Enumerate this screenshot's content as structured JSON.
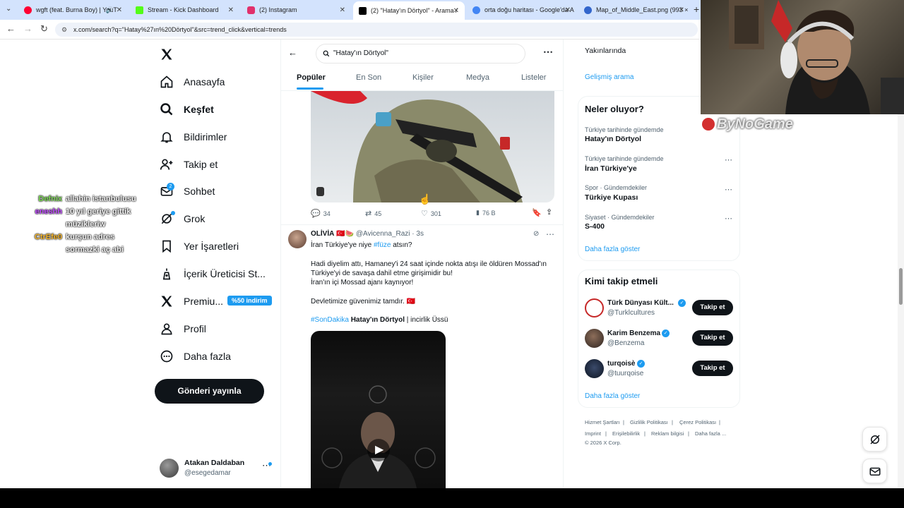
{
  "browser": {
    "tabs": [
      {
        "title": "wgft (feat. Burna Boy) | YouT",
        "color": "#ff0033"
      },
      {
        "title": "Stream - Kick Dashboard",
        "color": "#53fc18"
      },
      {
        "title": "(2) Instagram",
        "color": "#e1306c"
      },
      {
        "title": "(2) \"Hatay'ın Dörtyol\" - Arama /",
        "color": "#000000"
      },
      {
        "title": "orta doğu haritası - Google'da A",
        "color": "#4285f4"
      },
      {
        "title": "Map_of_Middle_East.png (993 ×",
        "color": "#3366cc"
      }
    ],
    "url": "x.com/search?q=\"Hatay%27ın%20Dörtyol\"&src=trend_click&vertical=trends"
  },
  "nav": {
    "items": [
      {
        "label": "Anasayfa",
        "icon": "home-icon"
      },
      {
        "label": "Keşfet",
        "icon": "search-icon"
      },
      {
        "label": "Bildirimler",
        "icon": "bell-icon"
      },
      {
        "label": "Takip et",
        "icon": "person-plus-icon"
      },
      {
        "label": "Sohbet",
        "icon": "mail-icon",
        "badge": "2"
      },
      {
        "label": "Grok",
        "icon": "grok-icon"
      },
      {
        "label": "Yer İşaretleri",
        "icon": "bookmark-icon"
      },
      {
        "label": "İçerik Üreticisi St...",
        "icon": "creator-icon"
      },
      {
        "label": "Premiu...",
        "icon": "x-logo-icon",
        "badge": "%50 indirim"
      },
      {
        "label": "Profil",
        "icon": "profile-icon"
      },
      {
        "label": "Daha fazla",
        "icon": "more-circle-icon"
      }
    ],
    "post_button": "Gönderi yayınla",
    "account": {
      "name": "Atakan Daldaban",
      "handle": "@esegedamar"
    }
  },
  "search": {
    "query": "\"Hatay'ın Dörtyol\"",
    "tabs": [
      "Popüler",
      "En Son",
      "Kişiler",
      "Medya",
      "Listeler"
    ]
  },
  "tweet1": {
    "replies": "34",
    "retweets": "45",
    "likes": "301",
    "views": "76 B"
  },
  "tweet2": {
    "name": "ΟLİVİA",
    "name_emoji": "🇹🇷🍉",
    "handle": "@Avicenna_Razi",
    "time": "· 3s",
    "line1_pre": "İran Türkiye'ye niye",
    "line1_tag": "#füze",
    "line1_post": "atsın?",
    "para1": "Hadi diyelim attı, Hamaney'i 24 saat içinde nokta atışı ile öldüren Mossad'ın Türkiye'yi de savaşa dahil etme girişimidir bu!",
    "para1b": "İran'ın içi Mossad ajanı kaynıyor!",
    "para2": "Devletimize güvenimiz tamdır. 🇹🇷",
    "tag_line_tag": "#SonDakika",
    "tag_line_bold": "Hatay'ın Dörtyol",
    "tag_line_rest": "| incirlik Üssü"
  },
  "right": {
    "location_text": "Yakınlarında",
    "advanced_search": "Gelişmiş arama",
    "trends_title": "Neler oluyor?",
    "trends": [
      {
        "context": "Türkiye tarihinde gündemde",
        "title": "Hatay'ın Dörtyol"
      },
      {
        "context": "Türkiye tarihinde gündemde",
        "title": "İran Türkiye'ye"
      },
      {
        "context": "Spor · Gündemdekiler",
        "title": "Türkiye Kupası"
      },
      {
        "context": "Siyaset · Gündemdekiler",
        "title": "S-400"
      }
    ],
    "show_more": "Daha fazla göster",
    "who_to_follow": "Kimi takip etmeli",
    "follow_list": [
      {
        "name": "Türk Dünyası Kült...",
        "handle": "@Turklcultures",
        "button": "Takip et"
      },
      {
        "name": "Karim Benzema",
        "handle": "@Benzema",
        "button": "Takip et"
      },
      {
        "name": "turqoisè",
        "handle": "@tuurqoise",
        "button": "Takip et"
      }
    ],
    "show_more2": "Daha fazla göster",
    "footer": [
      "Hizmet Şartları",
      "Gizlilik Politikası",
      "Çerez Politikası",
      "Imprint",
      "Erişilebilirlik",
      "Reklam bilgisi",
      "Daha fazla ...",
      "© 2026 X Corp."
    ]
  },
  "overlay": {
    "chat": [
      {
        "user": "Defnix",
        "user_color": "#7ed957",
        "msg": "allahin istanbulusu"
      },
      {
        "user": "eneshh",
        "user_color": "#c04cff",
        "msg": "10 yıl geriye gittik"
      },
      {
        "user": "",
        "user_color": "#ffffff",
        "msg": "müzikleriw"
      },
      {
        "user": "CtrEfe0",
        "user_color": "#f5b52a",
        "msg": "kurşun adres"
      },
      {
        "user": "",
        "user_color": "#ffffff",
        "msg": "sormazki aç abi"
      }
    ],
    "watermark": "ByNoGame"
  }
}
